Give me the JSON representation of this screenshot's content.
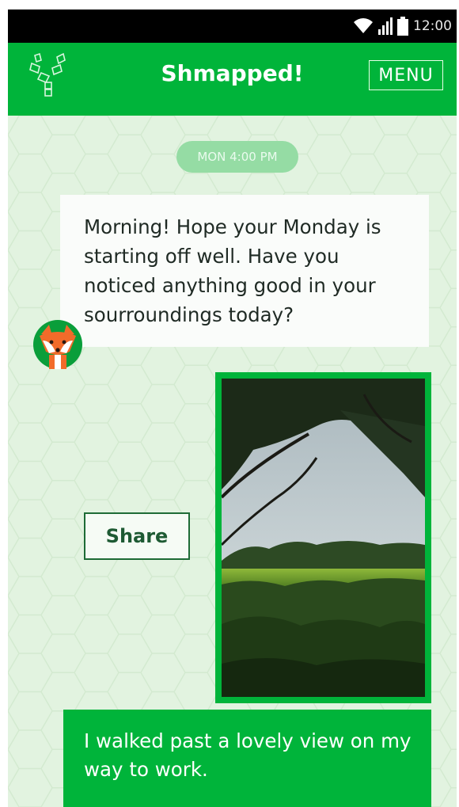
{
  "status_bar": {
    "time": "12:00"
  },
  "app_bar": {
    "title": "Shmapped!",
    "menu_label": "MENU"
  },
  "chat": {
    "timestamp": "MON 4:00 PM",
    "bot_message": "Morning! Hope your Monday is starting off well. Have you noticed anything good in your sourroundings today?",
    "share_label": "Share",
    "user_message": "I walked past a lovely view on my way to work."
  },
  "colors": {
    "brand_green": "#00b43a",
    "background": "#e2f3e0",
    "timestamp_pill": "#95dca4",
    "share_border": "#1e6b36"
  },
  "icons": {
    "logo": "tangram-branch-logo",
    "wifi": "wifi-icon",
    "signal": "signal-icon",
    "battery": "battery-icon",
    "avatar": "fox-avatar"
  }
}
